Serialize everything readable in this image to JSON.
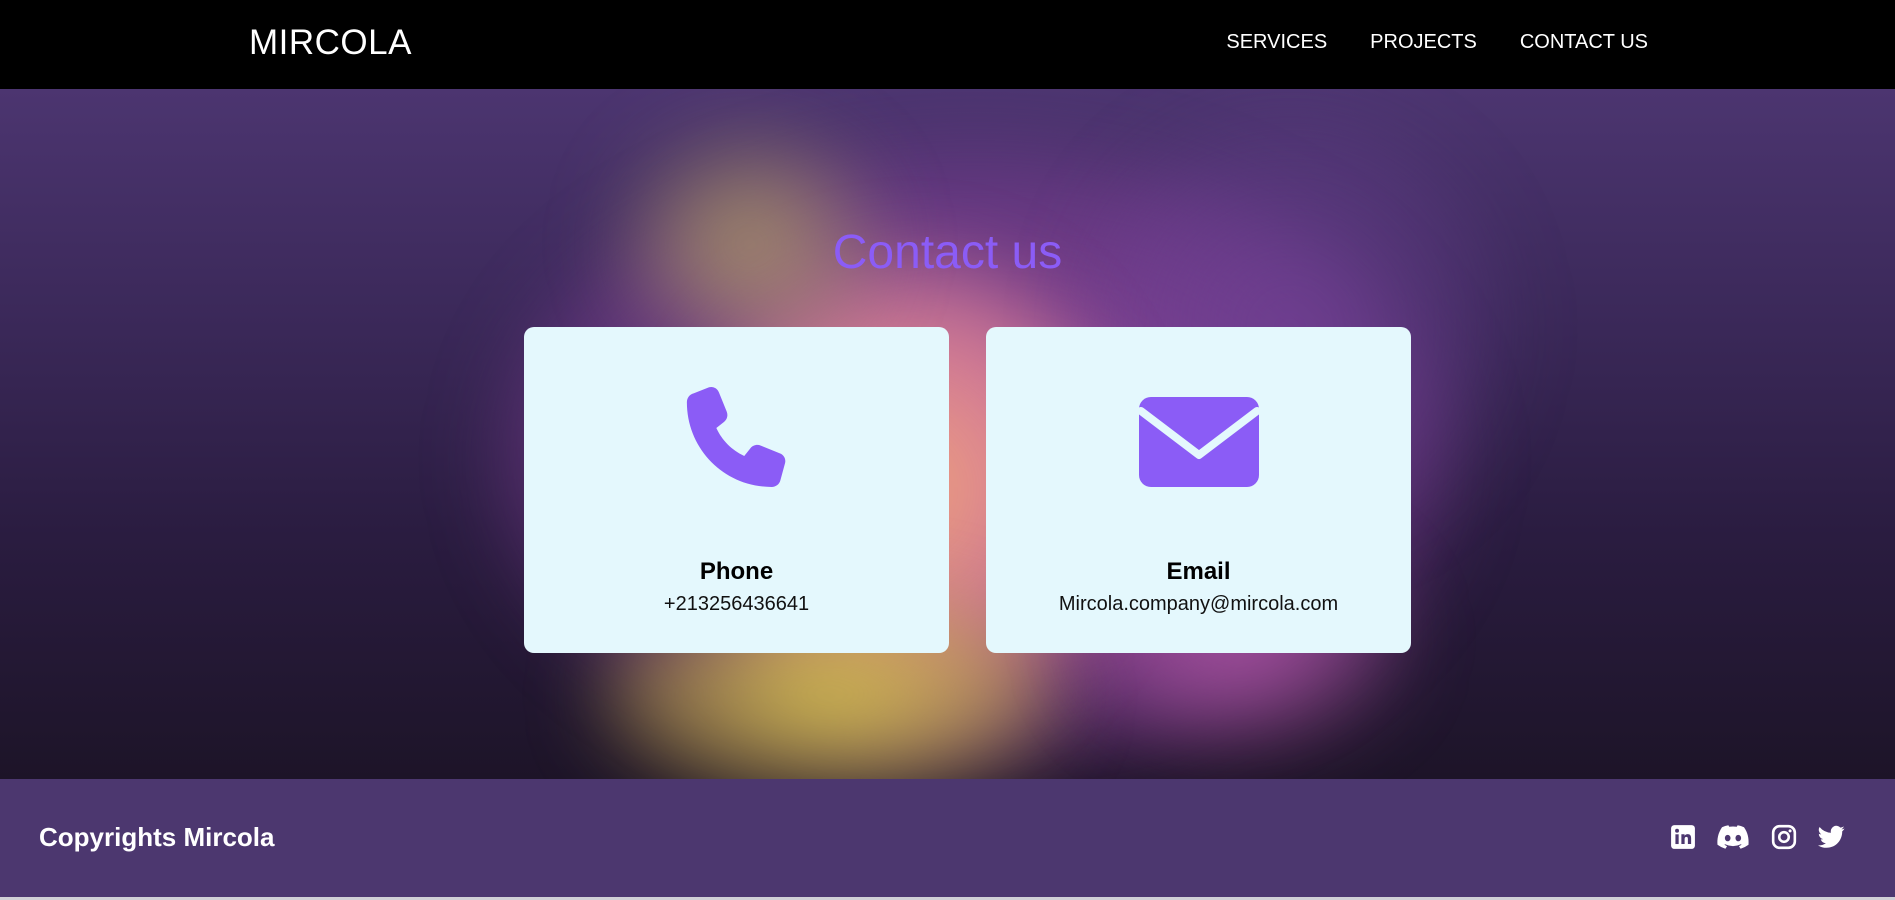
{
  "header": {
    "logo": "MIRCOLA",
    "nav": [
      {
        "label": "SERVICES"
      },
      {
        "label": "PROJECTS"
      },
      {
        "label": "CONTACT US"
      }
    ]
  },
  "contact": {
    "title": "Contact us",
    "cards": [
      {
        "icon": "phone-icon",
        "label": "Phone",
        "value": "+213256436641"
      },
      {
        "icon": "envelope-icon",
        "label": "Email",
        "value": "Mircola.company@mircola.com"
      }
    ]
  },
  "footer": {
    "copyright": "Copyrights Mircola",
    "social": [
      {
        "icon": "linkedin-icon"
      },
      {
        "icon": "discord-icon"
      },
      {
        "icon": "instagram-icon"
      },
      {
        "icon": "twitter-icon"
      }
    ]
  },
  "colors": {
    "accent": "#8b5cf6",
    "header_bg": "#000000",
    "footer_bg": "#4c376f",
    "card_bg": "#e4f8fd"
  }
}
